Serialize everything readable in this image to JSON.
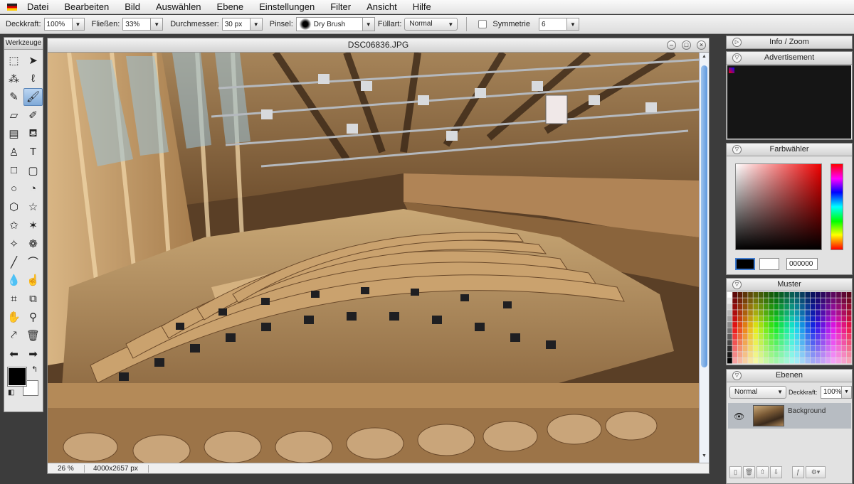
{
  "menu": {
    "items": [
      {
        "label": "Datei"
      },
      {
        "label": "Bearbeiten"
      },
      {
        "label": "Bild"
      },
      {
        "label": "Auswählen"
      },
      {
        "label": "Ebene"
      },
      {
        "label": "Einstellungen"
      },
      {
        "label": "Filter"
      },
      {
        "label": "Ansicht"
      },
      {
        "label": "Hilfe"
      }
    ]
  },
  "options": {
    "opacity_label": "Deckkraft:",
    "opacity_value": "100%",
    "flow_label": "Fließen:",
    "flow_value": "33%",
    "diameter_label": "Durchmesser:",
    "diameter_value": "30 px",
    "brush_label": "Pinsel:",
    "brush_value": "Dry Brush",
    "fill_label": "Füllart:",
    "fill_value": "Normal",
    "symmetry_label": "Symmetrie",
    "symmetry_value": "6"
  },
  "tools": {
    "title": "Werkzeuge",
    "items": [
      {
        "icon": "rect-select-icon",
        "glyph": "⬚"
      },
      {
        "icon": "move-icon",
        "glyph": "➤"
      },
      {
        "icon": "magic-wand-icon",
        "glyph": "⁂"
      },
      {
        "icon": "lasso-icon",
        "glyph": "ℓ"
      },
      {
        "icon": "pencil-icon",
        "glyph": "✎"
      },
      {
        "icon": "brush-icon",
        "glyph": "🖌",
        "active": true
      },
      {
        "icon": "eraser-icon",
        "glyph": "▱"
      },
      {
        "icon": "color-replace-icon",
        "glyph": "✐"
      },
      {
        "icon": "gradient-icon",
        "glyph": "▤"
      },
      {
        "icon": "paint-bucket-icon",
        "glyph": "⛾"
      },
      {
        "icon": "clone-stamp-icon",
        "glyph": "♙"
      },
      {
        "icon": "text-icon",
        "glyph": "T"
      },
      {
        "icon": "rectangle-icon",
        "glyph": "□"
      },
      {
        "icon": "rounded-rect-icon",
        "glyph": "▢"
      },
      {
        "icon": "ellipse-icon",
        "glyph": "○"
      },
      {
        "icon": "pie-icon",
        "glyph": "◔"
      },
      {
        "icon": "hexagon-icon",
        "glyph": "⬡"
      },
      {
        "icon": "star-icon",
        "glyph": "☆"
      },
      {
        "icon": "star5-icon",
        "glyph": "✩"
      },
      {
        "icon": "star6-icon",
        "glyph": "✶"
      },
      {
        "icon": "burst-icon",
        "glyph": "✧"
      },
      {
        "icon": "flower-icon",
        "glyph": "❁"
      },
      {
        "icon": "line-icon",
        "glyph": "╱"
      },
      {
        "icon": "curve-icon",
        "glyph": "⌒"
      },
      {
        "icon": "drop-icon",
        "glyph": "💧"
      },
      {
        "icon": "smudge-icon",
        "glyph": "☝"
      },
      {
        "icon": "crop-icon",
        "glyph": "⌗"
      },
      {
        "icon": "transform-icon",
        "glyph": "⧉"
      },
      {
        "icon": "hand-icon",
        "glyph": "✋"
      },
      {
        "icon": "zoom-icon",
        "glyph": "⚲"
      },
      {
        "icon": "eyedropper-icon",
        "glyph": "⤤"
      },
      {
        "icon": "trash-icon",
        "glyph": "🗑"
      },
      {
        "icon": "arrow-left-icon",
        "glyph": "⬅"
      },
      {
        "icon": "arrow-right-icon",
        "glyph": "➡"
      }
    ]
  },
  "document": {
    "title": "DSC06836.JPG",
    "zoom": "26 %",
    "dimensions": "4000x2657 px"
  },
  "panels": {
    "info_title": "Info / Zoom",
    "ad_title": "Advertisement",
    "color_title": "Farbwähler",
    "color_hex": "000000",
    "swatch_title": "Muster",
    "layers_title": "Ebenen",
    "layer_mode": "Normal",
    "layer_opacity_label": "Deckkraft:",
    "layer_opacity_value": "100%",
    "layer_name": "Background"
  },
  "colors": {
    "foreground": "#000000",
    "background": "#ffffff",
    "accent": "#5d97dd"
  }
}
